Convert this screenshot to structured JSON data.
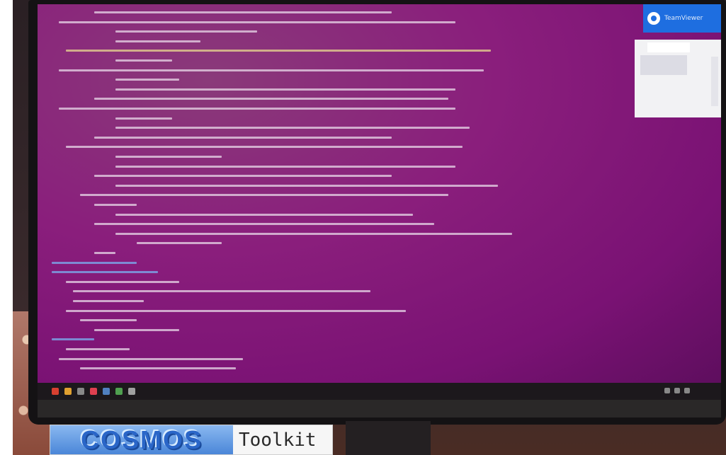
{
  "scene": {
    "description_type": "photo-of-monitor",
    "screen_color": "#8a1e7c",
    "overlay_app": {
      "title_text": "TeamViewer",
      "accent_color": "#1e6ee0"
    }
  },
  "watermark": {
    "brand": "COSMOS",
    "product": "Toolkit",
    "brand_color": "#4a86d8"
  },
  "code_colors": {
    "text": "#e8d8e8",
    "string": "#b8e0a0",
    "keyword": "#e8d890",
    "identifier": "#7ab0f0",
    "literal": "#f0b070"
  },
  "taskbar": {
    "icon_colors": [
      "#d84030",
      "#e0a030",
      "#888888",
      "#e04050",
      "#5080c0",
      "#50a050",
      "#a0a0a0"
    ]
  }
}
